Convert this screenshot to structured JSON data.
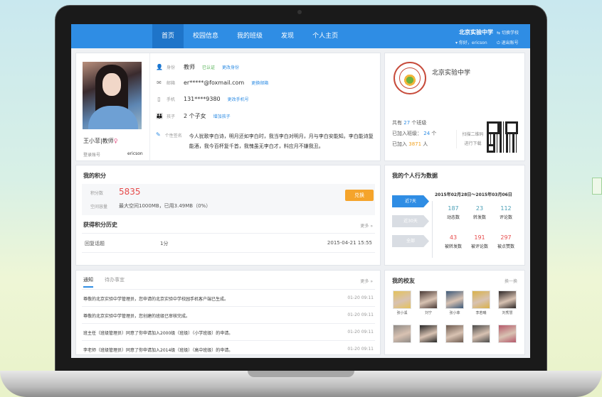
{
  "nav": {
    "items": [
      {
        "label": "首页",
        "active": true
      },
      {
        "label": "校园信息",
        "active": false
      },
      {
        "label": "我的班级",
        "active": false
      },
      {
        "label": "发现",
        "active": false
      },
      {
        "label": "个人主页",
        "active": false
      }
    ],
    "school": "北京实验中学",
    "switch_school": "切换学校",
    "greeting": "你好，ericson",
    "logout": "退出账号"
  },
  "profile": {
    "name": "王小菲|教师",
    "gender_symbol": "♀",
    "login_label": "登录账号",
    "login_value": "ericson",
    "rows": [
      {
        "label": "身份",
        "value": "教师",
        "action1": "已认证",
        "action2": "更改身份"
      },
      {
        "label": "邮箱",
        "value": "er*****@foxmail.com",
        "action1": "更换邮箱"
      },
      {
        "label": "手机",
        "value": "131****9380",
        "action1": "更改手机号"
      },
      {
        "label": "孩子",
        "value": "2 个子女",
        "action1": "增加孩子"
      }
    ],
    "signature_label": "个性签名",
    "signature": "今人犹歌李白诗，明月还如李白时，我当李白对明月，月与李白安能知。李白能诗复能酒，我今百杯复千首，我愧虽无李白才，料应月不嫌我丑。"
  },
  "school_card": {
    "name": "北京实验中学",
    "classes_prefix": "共有",
    "classes_count": "27",
    "classes_suffix": "个班级",
    "joined_classes_label": "已加入班级：",
    "joined_classes": "24",
    "joined_classes_unit": "个",
    "joined_people_label": "已加入",
    "joined_people": "3871",
    "joined_people_unit": "人",
    "qr_line1": "扫描二维码",
    "qr_line2": "进行下载"
  },
  "points": {
    "title": "我的积分",
    "points_label": "积分数",
    "points_value": "5835",
    "space_label": "空间容量",
    "space_value": "最大空间1000MB，已用3.49MB（0%）",
    "redeem": "兑换",
    "history_title": "获得积分历史",
    "more": "更多 »",
    "history": [
      {
        "action": "回复话题",
        "score": "1分",
        "date": "2015-04-21 15:55"
      }
    ]
  },
  "behavior": {
    "title": "我的个人行为数据",
    "buttons": [
      "近7天",
      "近30天",
      "全部"
    ],
    "range": "2015年02月28日～2015年03月06日",
    "stats": [
      {
        "value": "187",
        "label": "动态数"
      },
      {
        "value": "23",
        "label": "转发数"
      },
      {
        "value": "112",
        "label": "评论数"
      },
      {
        "value": "43",
        "label": "被转发数"
      },
      {
        "value": "191",
        "label": "被评论数"
      },
      {
        "value": "297",
        "label": "被点赞数"
      }
    ]
  },
  "notice": {
    "tabs": [
      "通知",
      "待办事宜"
    ],
    "more": "更多 »",
    "rows": [
      {
        "text": "尊敬的北京实验中学管理员，您申请的北京实验中学校园手机客户端已生成。",
        "date": "01-20 09:11"
      },
      {
        "text": "尊敬的北京实验中学管理员，您创建的班级已审核完成。",
        "date": "01-20 09:11"
      },
      {
        "text": "班主任（班级管理员）同意了你申请加入2000级（班级）（小学班级）的申请。",
        "date": "01-20 09:11"
      },
      {
        "text": "李老师（班级管理员）同意了你申请加入2014级（班级）（高中班级）的申请。",
        "date": "01-20 09:11"
      }
    ]
  },
  "friends": {
    "title": "我的校友",
    "change": "换一换",
    "people": [
      {
        "name": "张小溪",
        "color": "#e4c25a"
      },
      {
        "name": "刘宁",
        "color": "#4a3a36"
      },
      {
        "name": "张小菲",
        "color": "#3d5a7a"
      },
      {
        "name": "李若曦",
        "color": "#d9b14a"
      },
      {
        "name": "刘秀慧",
        "color": "#2d2727"
      },
      {
        "name": "",
        "color": "#8f8a86"
      },
      {
        "name": "",
        "color": "#262626"
      },
      {
        "name": "",
        "color": "#6d5b50"
      },
      {
        "name": "",
        "color": "#4a4a4a"
      },
      {
        "name": "",
        "color": "#b5586a"
      }
    ]
  }
}
